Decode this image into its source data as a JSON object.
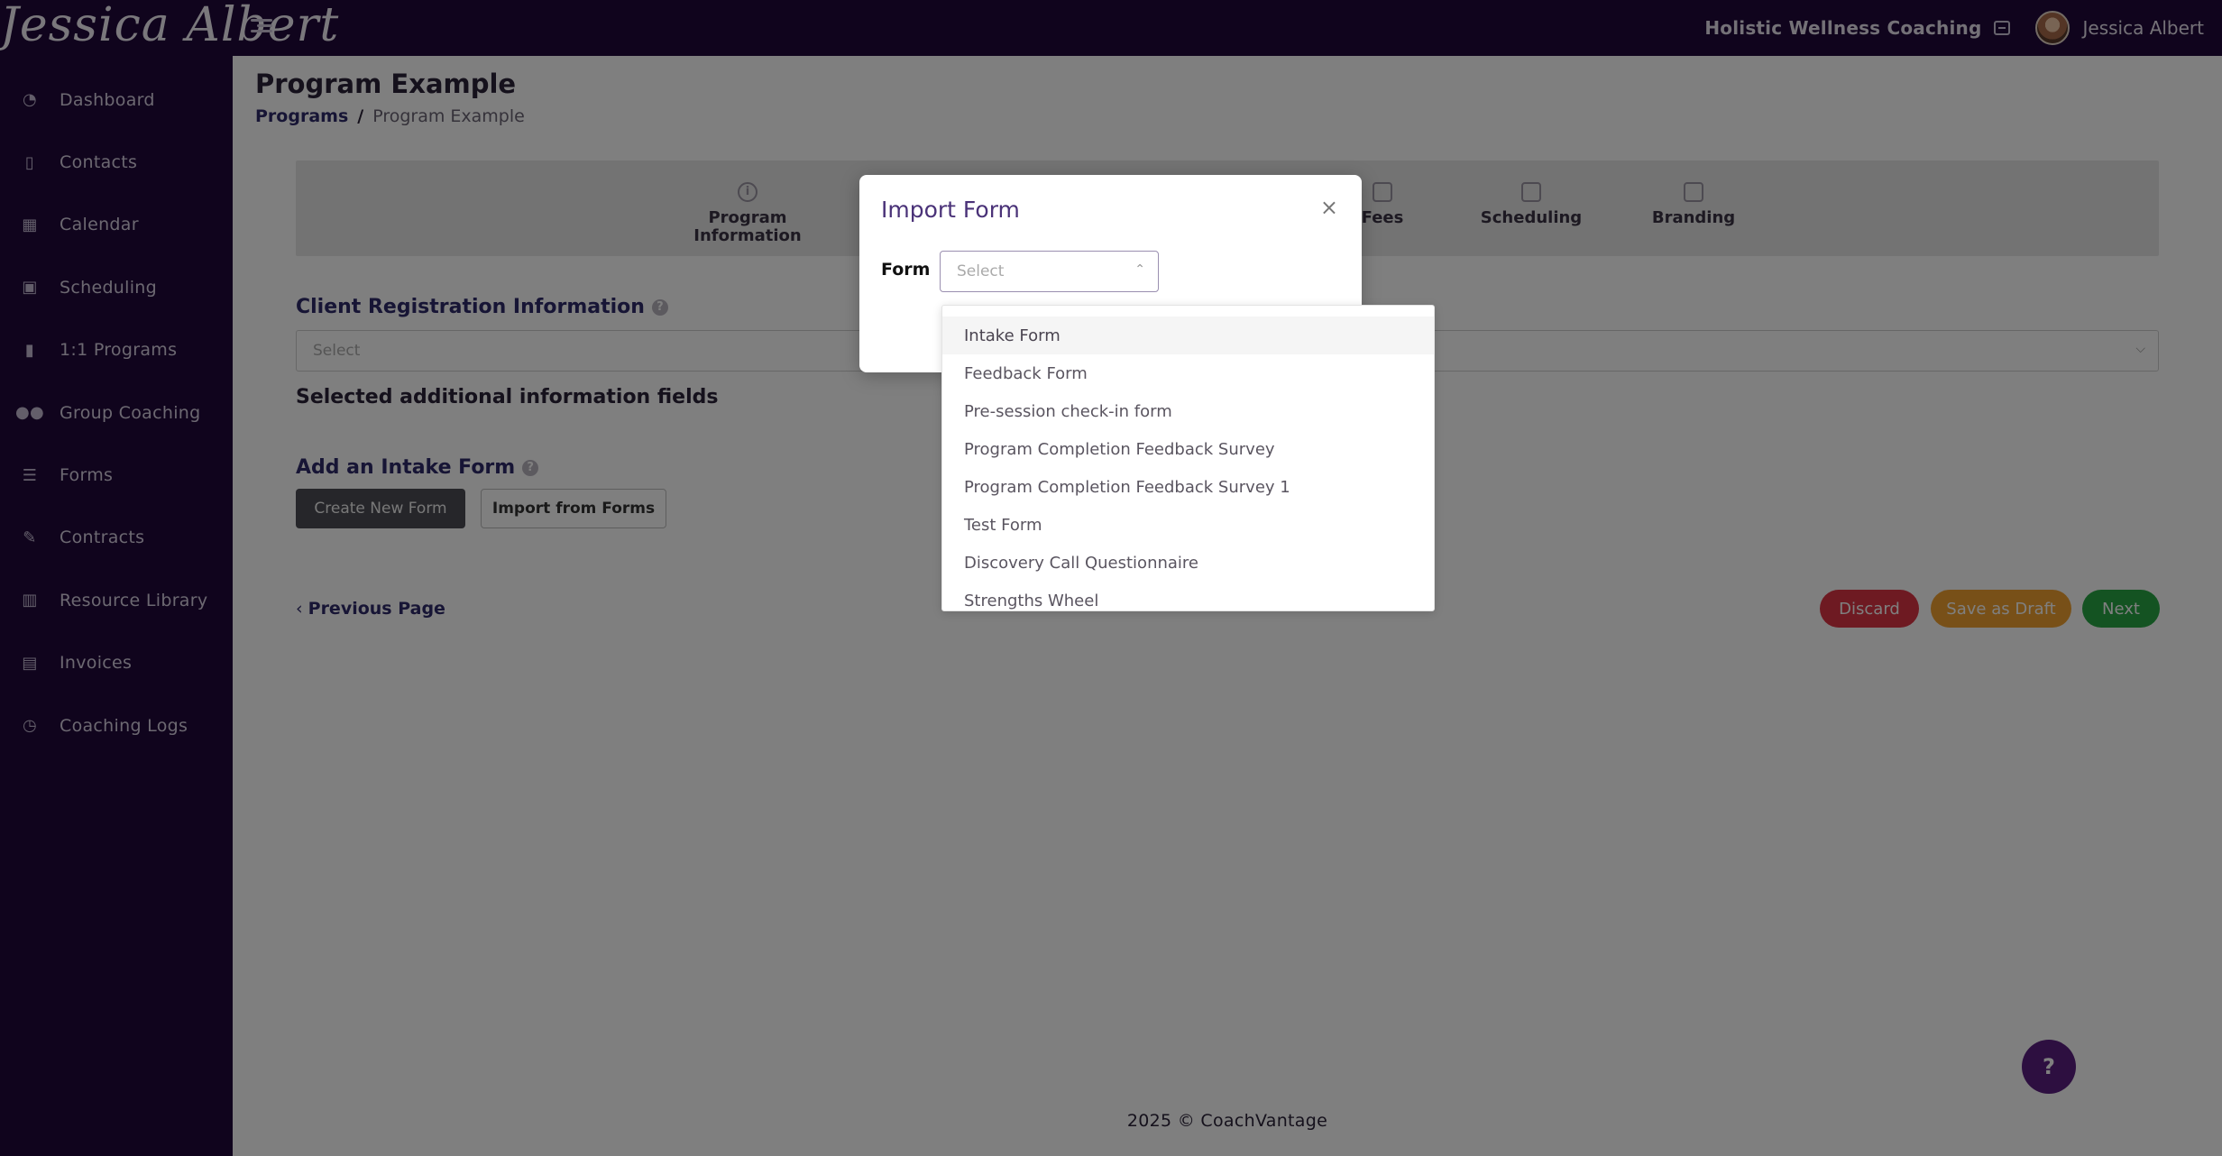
{
  "app": {
    "logo_text": "Jessica Albert",
    "business_name": "Holistic Wellness Coaching",
    "user_name": "Jessica Albert"
  },
  "sidebar": {
    "items": [
      {
        "label": "Dashboard",
        "icon": "dashboard-icon"
      },
      {
        "label": "Contacts",
        "icon": "contacts-icon"
      },
      {
        "label": "Calendar",
        "icon": "calendar-icon"
      },
      {
        "label": "Scheduling",
        "icon": "scheduling-icon"
      },
      {
        "label": "1:1 Programs",
        "icon": "book-icon"
      },
      {
        "label": "Group Coaching",
        "icon": "group-icon"
      },
      {
        "label": "Forms",
        "icon": "list-check-icon"
      },
      {
        "label": "Contracts",
        "icon": "signature-icon"
      },
      {
        "label": "Resource Library",
        "icon": "library-icon"
      },
      {
        "label": "Invoices",
        "icon": "invoice-icon"
      },
      {
        "label": "Coaching Logs",
        "icon": "clock-icon"
      }
    ]
  },
  "page": {
    "title": "Program Example",
    "breadcrumb_link": "Programs",
    "breadcrumb_sep": "/",
    "breadcrumb_current": "Program Example"
  },
  "stepper": {
    "steps": [
      {
        "label": "Program Information"
      },
      {
        "label": "Fees"
      },
      {
        "label": "Scheduling"
      },
      {
        "label": "Branding"
      }
    ]
  },
  "form_section": {
    "client_registration_title": "Client Registration Information",
    "client_registration_placeholder": "Select",
    "selected_fields_heading": "Selected additional information fields",
    "intake_title": "Add an Intake Form",
    "create_new_label": "Create New Form",
    "import_label": "Import from Forms",
    "help_glyph": "?"
  },
  "nav": {
    "previous_label": "Previous Page",
    "discard_label": "Discard",
    "save_draft_label": "Save as Draft",
    "next_label": "Next"
  },
  "footer": {
    "text": "2025 © CoachVantage"
  },
  "help_fab": {
    "label": "?"
  },
  "modal": {
    "title": "Import Form",
    "form_label": "Form",
    "select_placeholder": "Select",
    "close_glyph": "×"
  },
  "dropdown": {
    "options": [
      "Intake Form",
      "Feedback Form",
      "Pre-session check-in form",
      "Program Completion Feedback Survey",
      "Program Completion Feedback Survey 1",
      "Test Form",
      "Discovery Call Questionnaire",
      "Strengths Wheel"
    ],
    "hovered_index": 0
  },
  "colors": {
    "sidebar_bg": "#20093b",
    "accent_purple": "#5a1f80",
    "discard": "#dc3545",
    "save_draft": "#f0a030",
    "next": "#28a745"
  }
}
